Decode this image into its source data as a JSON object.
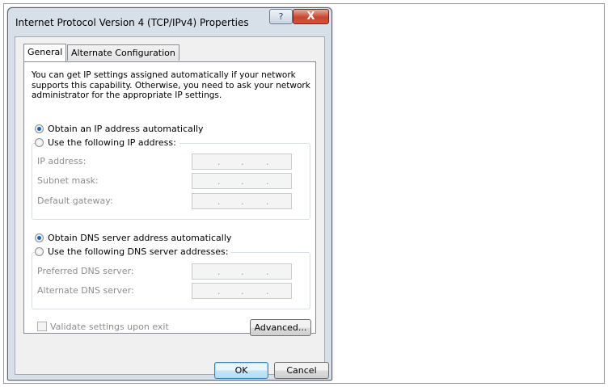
{
  "window": {
    "title": "Internet Protocol Version 4 (TCP/IPv4) Properties",
    "help_label": "?",
    "close_label": "X"
  },
  "tabs": [
    {
      "label": "General",
      "active": true
    },
    {
      "label": "Alternate Configuration",
      "active": false
    }
  ],
  "general": {
    "intro": "You can get IP settings assigned automatically if your network supports this capability. Otherwise, you need to ask your network administrator for the appropriate IP settings.",
    "ip": {
      "auto_label": "Obtain an IP address automatically",
      "auto_selected": true,
      "manual_label": "Use the following IP address:",
      "fields": [
        {
          "label": "IP address:",
          "value": ". . ."
        },
        {
          "label": "Subnet mask:",
          "value": ". . ."
        },
        {
          "label": "Default gateway:",
          "value": ". . ."
        }
      ]
    },
    "dns": {
      "auto_label": "Obtain DNS server address automatically",
      "auto_selected": true,
      "manual_label": "Use the following DNS server addresses:",
      "fields": [
        {
          "label": "Preferred DNS server:",
          "value": ". . ."
        },
        {
          "label": "Alternate DNS server:",
          "value": ". . ."
        }
      ]
    },
    "validate_label": "Validate settings upon exit",
    "validate_checked": false,
    "advanced_label": "Advanced..."
  },
  "footer": {
    "ok_label": "OK",
    "cancel_label": "Cancel"
  },
  "colors": {
    "radio_selected": "#1c63b8",
    "close_button": "#c8452f",
    "disabled_text": "#8d8d8d"
  }
}
